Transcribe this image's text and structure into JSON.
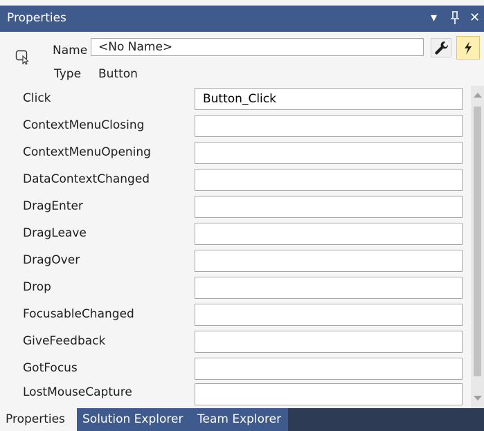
{
  "window": {
    "title": "Properties"
  },
  "header": {
    "name_label": "Name",
    "name_value": "<No Name>",
    "type_label": "Type",
    "type_value": "Button"
  },
  "events": [
    {
      "name": "Click",
      "value": "Button_Click"
    },
    {
      "name": "ContextMenuClosing",
      "value": ""
    },
    {
      "name": "ContextMenuOpening",
      "value": ""
    },
    {
      "name": "DataContextChanged",
      "value": ""
    },
    {
      "name": "DragEnter",
      "value": ""
    },
    {
      "name": "DragLeave",
      "value": ""
    },
    {
      "name": "DragOver",
      "value": ""
    },
    {
      "name": "Drop",
      "value": ""
    },
    {
      "name": "FocusableChanged",
      "value": ""
    },
    {
      "name": "GiveFeedback",
      "value": ""
    },
    {
      "name": "GotFocus",
      "value": ""
    },
    {
      "name": "LostMouseCapture",
      "value": ""
    }
  ],
  "tabs": [
    {
      "label": "Properties",
      "active": true
    },
    {
      "label": "Solution Explorer",
      "active": false
    },
    {
      "label": "Team Explorer",
      "active": false
    }
  ],
  "icons": {
    "dropdown": "dropdown-arrow-icon",
    "pin": "pin-icon",
    "close": "close-icon",
    "selector": "cursor-selector-icon",
    "properties": "wrench-icon",
    "events": "lightning-bolt-icon"
  },
  "colors": {
    "titlebar": "#3f5a8c",
    "tabbar": "#2d3b54",
    "events_button": "#ffefb0"
  }
}
